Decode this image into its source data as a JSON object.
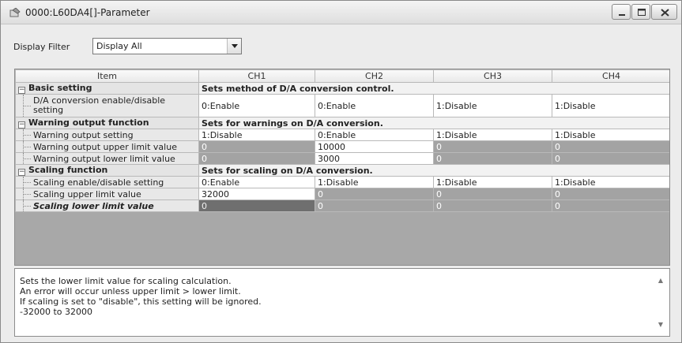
{
  "window": {
    "title": "0000:L60DA4[]-Parameter"
  },
  "filter": {
    "label": "Display Filter",
    "value": "Display All"
  },
  "grid": {
    "headers": [
      "Item",
      "CH1",
      "CH2",
      "CH3",
      "CH4"
    ],
    "basic": {
      "label": "Basic setting",
      "desc": "Sets method of D/A conversion control.",
      "rows": [
        {
          "label": "D/A conversion enable/disable setting",
          "v": [
            "0:Enable",
            "0:Enable",
            "1:Disable",
            "1:Disable"
          ]
        }
      ]
    },
    "warning": {
      "label": "Warning output function",
      "desc": "Sets for warnings on D/A conversion.",
      "rows": [
        {
          "label": "Warning output setting",
          "v": [
            "1:Disable",
            "0:Enable",
            "1:Disable",
            "1:Disable"
          ]
        },
        {
          "label": "Warning output upper limit value",
          "v": [
            "0",
            "10000",
            "0",
            "0"
          ]
        },
        {
          "label": "Warning output lower limit value",
          "v": [
            "0",
            "3000",
            "0",
            "0"
          ]
        }
      ]
    },
    "scaling": {
      "label": "Scaling function",
      "desc": "Sets for scaling on D/A conversion.",
      "rows": [
        {
          "label": "Scaling enable/disable setting",
          "v": [
            "0:Enable",
            "1:Disable",
            "1:Disable",
            "1:Disable"
          ]
        },
        {
          "label": "Scaling upper limit value",
          "v": [
            "32000",
            "0",
            "0",
            "0"
          ]
        },
        {
          "label": "Scaling lower limit value",
          "v": [
            "0",
            "0",
            "0",
            "0"
          ]
        }
      ]
    }
  },
  "description": [
    "Sets the lower limit value for scaling calculation.",
    "An error will occur unless upper limit > lower limit.",
    "If scaling is set to \"disable\", this setting will be ignored.",
    "-32000 to 32000"
  ],
  "icons": {
    "title": "parameter-icon",
    "minimize": "minimize-icon",
    "maximize": "maximize-icon",
    "close": "close-icon",
    "dropdown": "chevron-down-icon",
    "expand": "collapse-minus-icon"
  }
}
